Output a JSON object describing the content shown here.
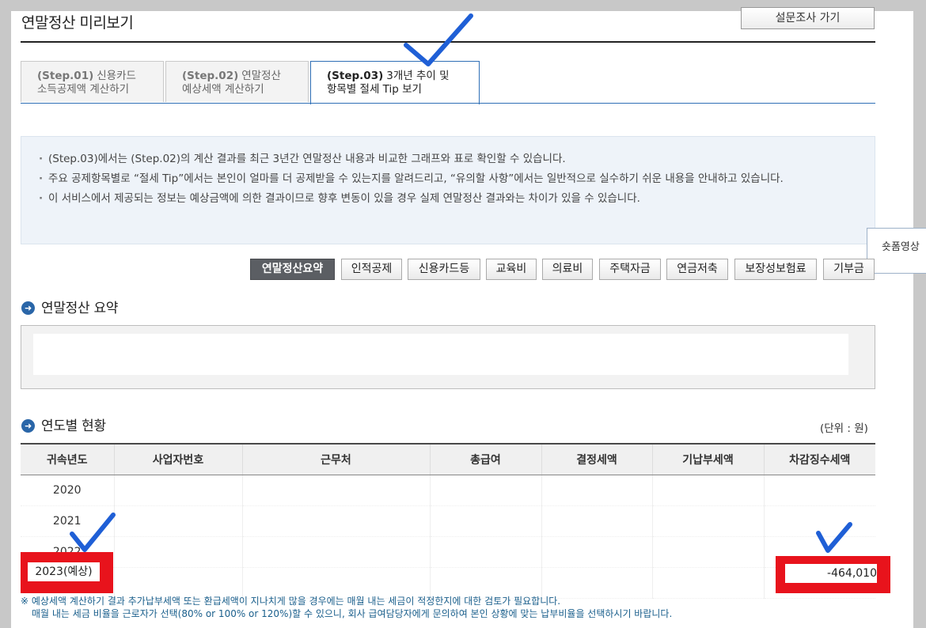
{
  "page": {
    "title": "연말정산 미리보기",
    "survey_button": "설문조사 가기"
  },
  "tabs": [
    {
      "step": "(Step.01)",
      "line1": "신용카드",
      "line2": "소득공제액 계산하기",
      "active": false
    },
    {
      "step": "(Step.02)",
      "line1": "연말정산",
      "line2": "예상세액 계산하기",
      "active": false
    },
    {
      "step": "(Step.03)",
      "line1": "3개년 추이 및",
      "line2": "항목별 절세 Tip 보기",
      "active": true
    }
  ],
  "info": {
    "items": [
      "(Step.03)에서는 (Step.02)의 계산 결과를 최근 3년간 연말정산 내용과 비교한 그래프와 표로 확인할 수 있습니다.",
      "주요 공제항목별로 “절세 Tip”에서는 본인이 얼마를 더 공제받을 수 있는지를 알려드리고, “유의할 사항”에서는 일반적으로 실수하기 쉬운 내용을 안내하고 있습니다.",
      "이 서비스에서 제공되는 정보는 예상금액에 의한 결과이므로 향후 변동이 있을 경우 실제 연말정산 결과와는 차이가 있을 수 있습니다."
    ]
  },
  "side_tooltip": "숏폼영상",
  "categories": [
    "연말정산요약",
    "인적공제",
    "신용카드등",
    "교육비",
    "의료비",
    "주택자금",
    "연금저축",
    "보장성보험료",
    "기부금"
  ],
  "active_category": "연말정산요약",
  "summary_section": {
    "title": "연말정산 요약"
  },
  "yearly_section": {
    "title": "연도별 현황",
    "unit": "(단위 : 원)",
    "columns": [
      "귀속년도",
      "사업자번호",
      "근무처",
      "총급여",
      "결정세액",
      "기납부세액",
      "차감징수세액"
    ],
    "rows": [
      {
        "year": "2020",
        "amount": ""
      },
      {
        "year": "2021",
        "amount": ""
      },
      {
        "year": "2022",
        "amount": ""
      },
      {
        "year": "2023(예상)",
        "amount": "-464,010"
      }
    ]
  },
  "footnote": {
    "line1": "※ 예상세액 계산하기 결과 추가납부세액 또는 환급세액이 지나치게 많을 경우에는 매월 내는 세금이 적정한지에 대한 검토가 필요합니다.",
    "line2": "매월 내는 세금 비율을 근로자가 선택(80% or 100% or 120%)할 수 있으니, 회사 급여담당자에게 문의하여 본인 상황에 맞는 납부비율을 선택하시기 바랍니다."
  },
  "colors": {
    "accent": "#2f6fb6",
    "highlight": "#e8131c",
    "check_mark": "#1f5fd6"
  }
}
